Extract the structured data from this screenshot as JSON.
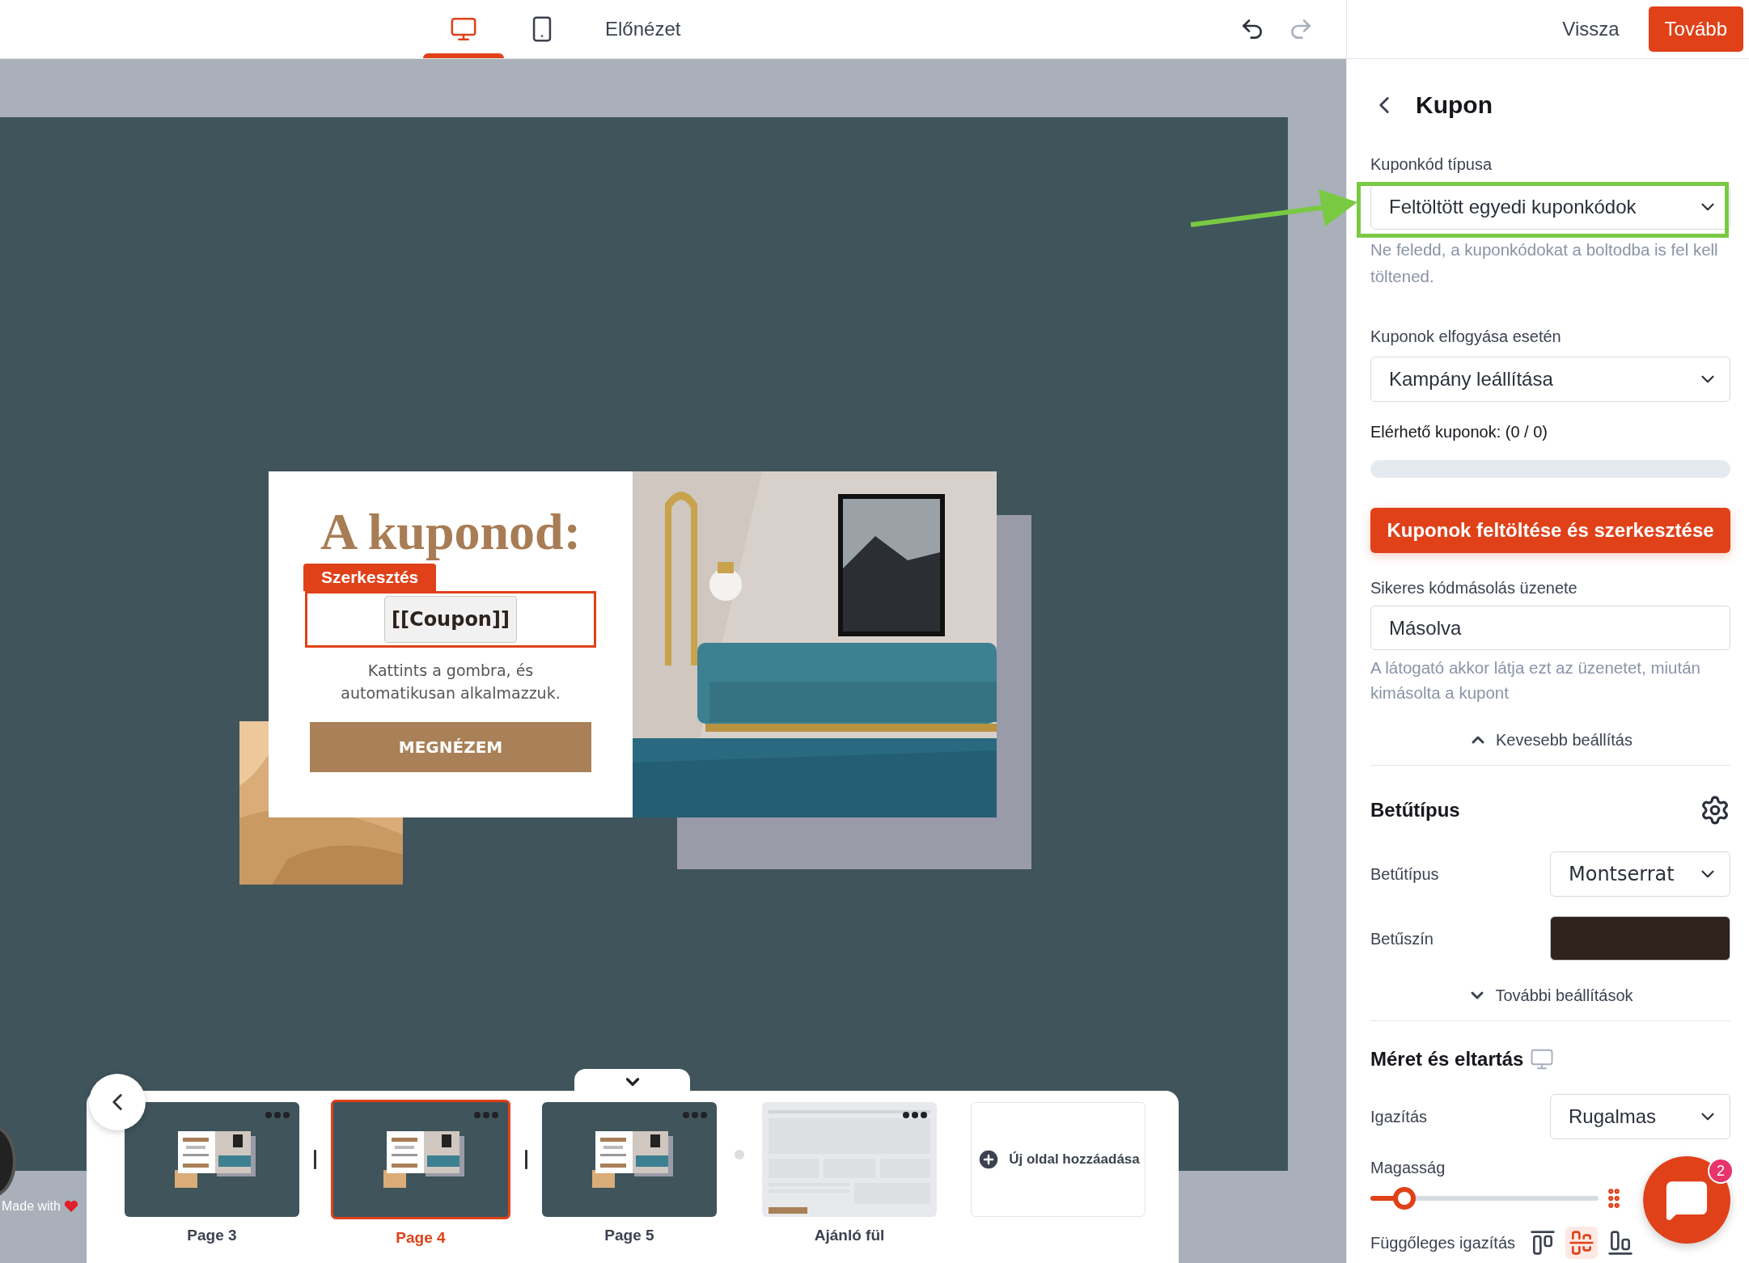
{
  "topbar": {
    "views": [
      {
        "kind": "desktop",
        "selected": true
      },
      {
        "kind": "mobile",
        "selected": false
      }
    ],
    "preview": "Előnézet",
    "undo": {
      "disabled": false
    },
    "redo": {
      "disabled": true
    },
    "back": "Vissza",
    "next": "Tovább"
  },
  "canvas": {
    "popup": {
      "heading": "A kuponod:",
      "edit_badge": "Szerkesztés",
      "coupon": "[[Coupon]]",
      "text": "Kattints a gombra, és automatikusan alkalmazzuk.",
      "button": "MEGNÉZEM"
    },
    "made_with": "Made with"
  },
  "pages": {
    "items": [
      {
        "label": "Page 3",
        "selected": false,
        "kind": "popup"
      },
      {
        "label": "Page 4",
        "selected": true,
        "kind": "popup"
      },
      {
        "label": "Page 5",
        "selected": false,
        "kind": "popup"
      },
      {
        "label": "Ajánló fül",
        "selected": false,
        "kind": "sidetab"
      }
    ],
    "add": "Új oldal hozzáadása"
  },
  "panel": {
    "title": "Kupon",
    "coupon_type": {
      "label": "Kuponkód típusa",
      "value": "Feltöltött egyedi kuponkódok",
      "hint": "Ne feledd, a kuponkódokat a boltodba is fel kell töltened."
    },
    "on_empty": {
      "label": "Kuponok elfogyása esetén",
      "value": "Kampány leállítása"
    },
    "available": {
      "label": "Elérhető kuponok: (0 / 0)",
      "level": 0
    },
    "upload_button": "Kuponok feltöltése és szerkesztése",
    "copy_message": {
      "label": "Sikeres kódmásolás üzenete",
      "value": "Másolva",
      "hint": "A látogató akkor látja ezt az üzenetet, miután kimásolta a kupont"
    },
    "less_toggle": {
      "label": "Kevesebb beállítás",
      "expanded": true
    },
    "font_section": {
      "title": "Betűtípus",
      "font": {
        "label": "Betűtípus",
        "value": "Montserrat"
      },
      "color": {
        "label": "Betűszín",
        "color": "#2e231d"
      },
      "more": {
        "label": "További beállítások",
        "expanded": false
      }
    },
    "size_section": {
      "title": "Méret és eltartás",
      "align": {
        "label": "Igazítás",
        "value": "Rugalmas"
      },
      "height": {
        "label": "Magasság",
        "level": 0.15
      },
      "vertical": {
        "label": "Függőleges igazítás",
        "options": [
          {
            "kind": "top",
            "selected": false
          },
          {
            "kind": "center",
            "selected": true
          },
          {
            "kind": "bottom",
            "selected": false
          }
        ]
      }
    }
  },
  "chat": {
    "badge": "2"
  }
}
